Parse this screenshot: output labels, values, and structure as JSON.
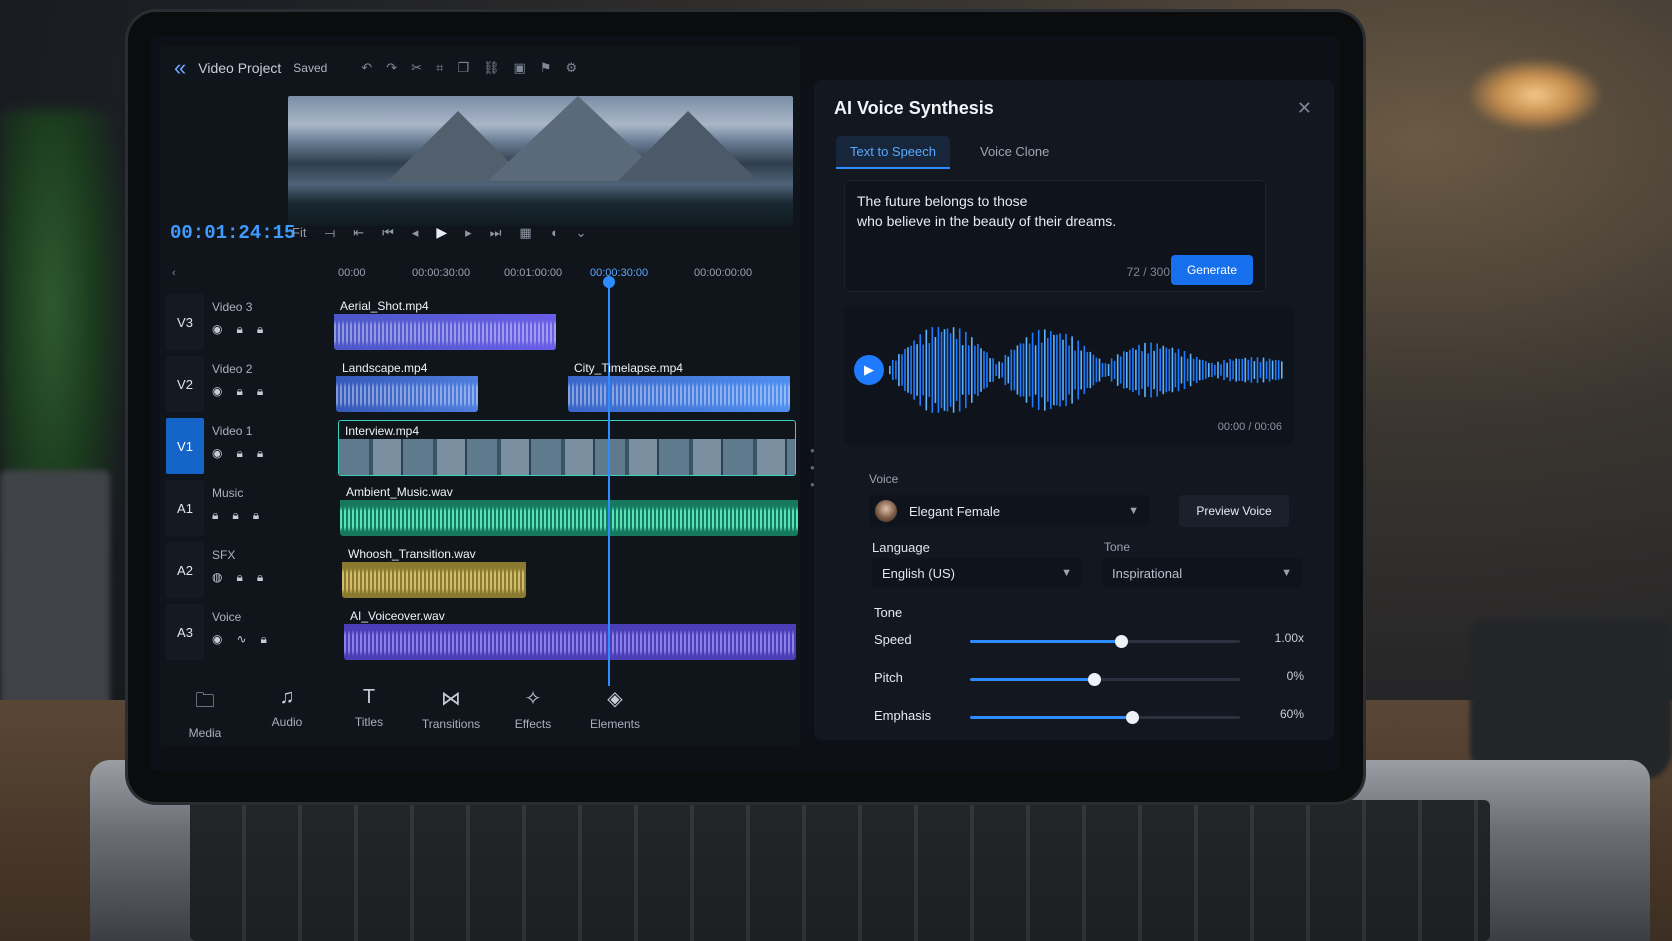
{
  "editor": {
    "project_title": "Video Project",
    "saved_status": "Saved",
    "timecode": "00:01:24:15",
    "fit_label": "Fit",
    "ruler_marks": [
      "00:00",
      "00:00:30:00",
      "00:01:00:00",
      "00:00:30:00",
      "00:00:00:00"
    ],
    "tracks": [
      {
        "id": "V3",
        "name": "Video 3",
        "clips": [
          {
            "name": "Aerial_Shot.mp4",
            "color": "#6a5ee8"
          }
        ]
      },
      {
        "id": "V2",
        "name": "Video 2",
        "clips": [
          {
            "name": "Landscape.mp4",
            "color": "#3f6fd6"
          },
          {
            "name": "City_Timelapse.mp4",
            "color": "#3f6fd6"
          }
        ]
      },
      {
        "id": "V1",
        "name": "Video 1",
        "clips": [
          {
            "name": "Interview.mp4",
            "color": "#1ea99a"
          }
        ]
      },
      {
        "id": "A1",
        "name": "Music",
        "clips": [
          {
            "name": "Ambient_Music.wav",
            "color": "#1fb58c"
          }
        ]
      },
      {
        "id": "A2",
        "name": "SFX",
        "clips": [
          {
            "name": "Whoosh_Transition.wav",
            "color": "#b39a3a"
          }
        ]
      },
      {
        "id": "A3",
        "name": "Voice",
        "clips": [
          {
            "name": "AI_Voiceover.wav",
            "color": "#6a56e6"
          }
        ]
      }
    ],
    "bottom_nav": [
      {
        "label": "Media",
        "icon": "folder-icon"
      },
      {
        "label": "Audio",
        "icon": "music-note-icon"
      },
      {
        "label": "Titles",
        "icon": "text-icon"
      },
      {
        "label": "Transitions",
        "icon": "transition-icon"
      },
      {
        "label": "Effects",
        "icon": "sparkle-icon"
      },
      {
        "label": "Elements",
        "icon": "elements-icon"
      }
    ]
  },
  "voice_panel": {
    "title": "AI Voice Synthesis",
    "tabs": [
      "Text to Speech",
      "Voice Clone"
    ],
    "text_line1": "The future belongs to those",
    "text_line2": "who believe in the beauty of their dreams.",
    "char_count": "72 / 300",
    "generate_label": "Generate",
    "playback_time": "00:00 / 00:06",
    "voice_label": "Voice",
    "voice_value": "Elegant Female",
    "preview_label": "Preview Voice",
    "language_label": "Language",
    "language_value": "English (US)",
    "tone_label": "Tone",
    "tone_value": "Inspirational",
    "tone_section_label": "Tone",
    "sliders": [
      {
        "label": "Speed",
        "value_text": "1.00x",
        "level": 0.56
      },
      {
        "label": "Pitch",
        "value_text": "0%",
        "level": 0.46
      },
      {
        "label": "Emphasis",
        "value_text": "60%",
        "level": 0.6
      }
    ]
  },
  "colors": {
    "accent": "#2d8cff",
    "panel_bg": "#121720"
  }
}
